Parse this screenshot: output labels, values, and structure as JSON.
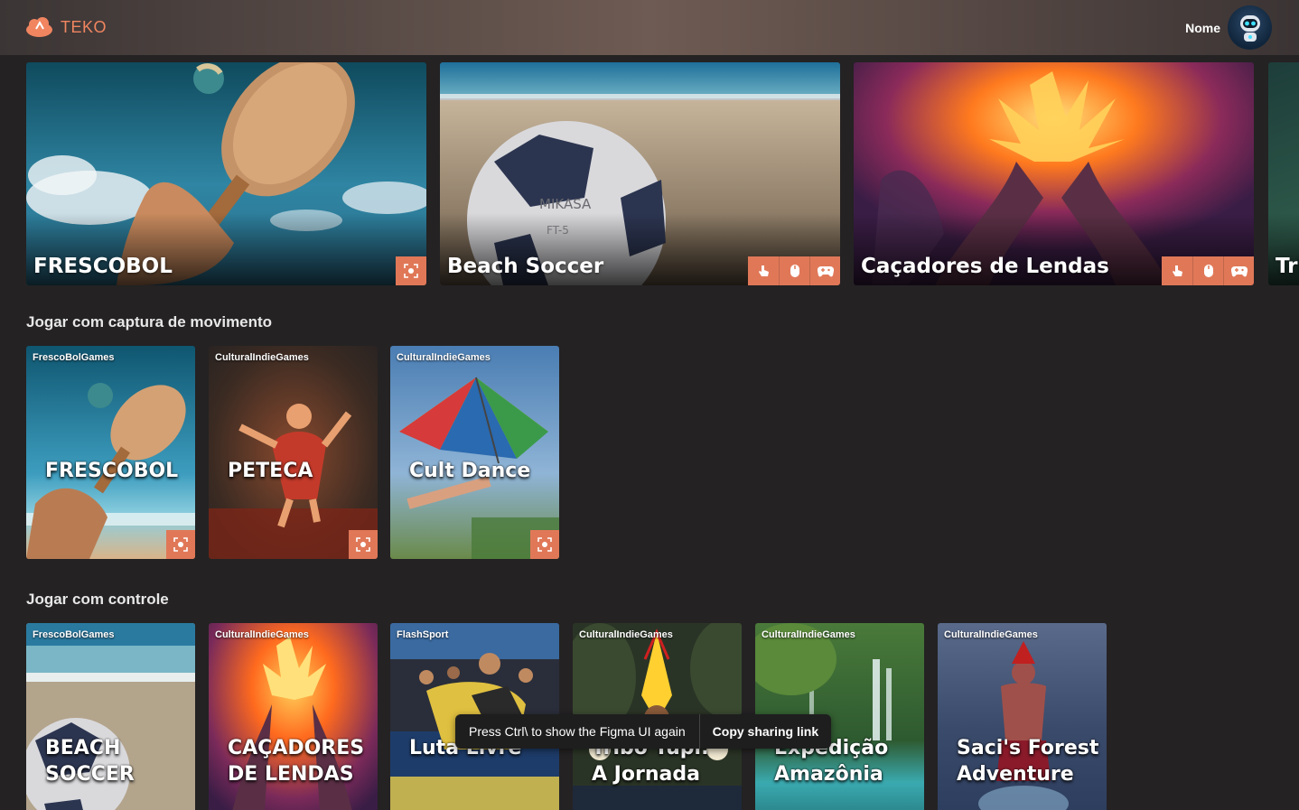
{
  "header": {
    "brand": "TEKO",
    "user_name": "Nome",
    "logo_icon": "cloud-logo-icon",
    "avatar_icon": "robot-avatar-icon"
  },
  "featured": [
    {
      "title": "FRESCOBOL",
      "icons": [
        "motion-capture-icon"
      ]
    },
    {
      "title": "Beach Soccer",
      "icons": [
        "touch-icon",
        "mouse-icon",
        "gamepad-icon"
      ]
    },
    {
      "title": "Caçadores de Lendas",
      "icons": [
        "touch-icon",
        "mouse-icon",
        "gamepad-icon"
      ]
    },
    {
      "title": "Tri"
    }
  ],
  "sections": {
    "motion": {
      "title": "Jogar com captura de movimento",
      "cards": [
        {
          "studio": "FrescoBolGames",
          "name": "FRESCOBOL"
        },
        {
          "studio": "CulturalIndieGames",
          "name": "PETECA"
        },
        {
          "studio": "CulturalIndieGames",
          "name": "Cult Dance"
        }
      ]
    },
    "controller": {
      "title": "Jogar com controle",
      "cards": [
        {
          "studio": "FrescoBolGames",
          "name_line1": "BEACH",
          "name_line2": "SOCCER"
        },
        {
          "studio": "CulturalIndieGames",
          "name_line1": "CAÇADORES",
          "name_line2": "DE LENDAS"
        },
        {
          "studio": "FlashSport",
          "name_line1": "Luta Livre",
          "name_line2": ""
        },
        {
          "studio": "CulturalIndieGames",
          "name_line1": "Tribo Tupi:",
          "name_line2": "A Jornada"
        },
        {
          "studio": "CulturalIndieGames",
          "name_line1": "Expedição",
          "name_line2": "Amazônia"
        },
        {
          "studio": "CulturalIndieGames",
          "name_line1": "Saci's Forest",
          "name_line2": "Adventure"
        }
      ]
    }
  },
  "toast": {
    "message": "Press Ctrl\\ to show the Figma UI again",
    "action": "Copy sharing link"
  },
  "colors": {
    "accent": "#e07858",
    "background": "#242223",
    "brand": "#f08560"
  }
}
